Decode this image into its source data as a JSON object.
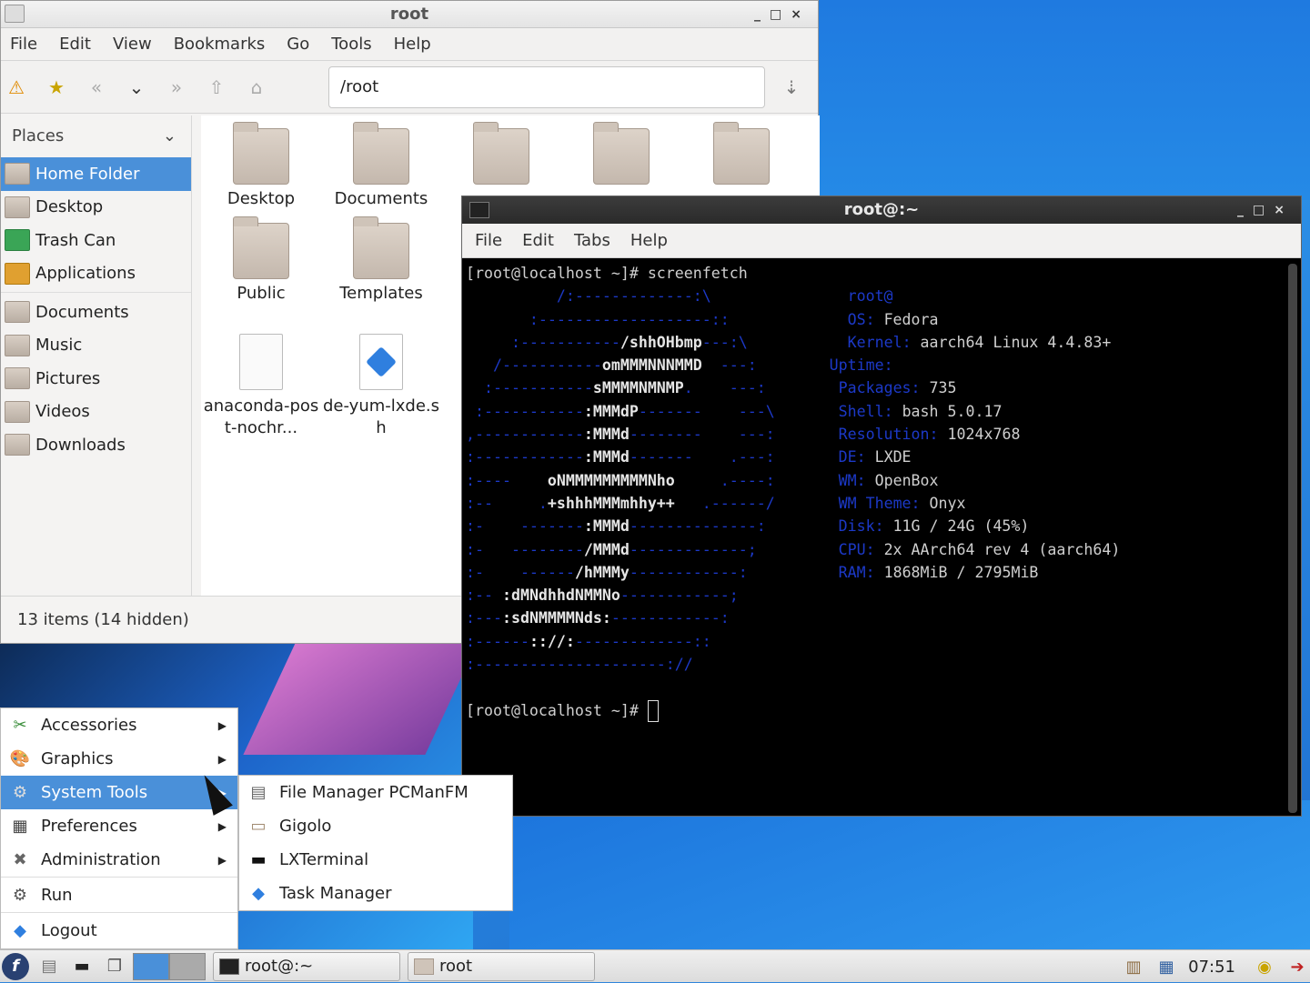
{
  "file_manager": {
    "title": "root",
    "window_controls": [
      "_",
      "□",
      "×"
    ],
    "menu": [
      "File",
      "Edit",
      "View",
      "Bookmarks",
      "Go",
      "Tools",
      "Help"
    ],
    "address": "/root",
    "places_label": "Places",
    "places": [
      {
        "label": "Home Folder",
        "icon": "home-folder-icon",
        "selected": true
      },
      {
        "label": "Desktop",
        "icon": "desktop-folder-icon"
      },
      {
        "label": "Trash Can",
        "icon": "trash-icon"
      },
      {
        "label": "Applications",
        "icon": "applications-icon"
      },
      {
        "label": "Documents",
        "icon": "documents-folder-icon"
      },
      {
        "label": "Music",
        "icon": "music-folder-icon"
      },
      {
        "label": "Pictures",
        "icon": "pictures-folder-icon"
      },
      {
        "label": "Videos",
        "icon": "videos-folder-icon"
      },
      {
        "label": "Downloads",
        "icon": "downloads-folder-icon"
      }
    ],
    "files": [
      {
        "name": "Desktop",
        "type": "folder"
      },
      {
        "name": "Documents",
        "type": "folder"
      },
      {
        "name": "Public",
        "type": "folder"
      },
      {
        "name": "Templates",
        "type": "folder"
      },
      {
        "name": "anaconda-post-nochr...",
        "type": "text"
      },
      {
        "name": "de-yum-lxde.sh",
        "type": "script"
      }
    ],
    "status": "13 items (14 hidden)"
  },
  "terminal": {
    "title": "root@:~",
    "menu": [
      "File",
      "Edit",
      "Tabs",
      "Help"
    ],
    "prompt": "[root@localhost ~]# ",
    "command": "screenfetch",
    "info": [
      {
        "key": "",
        "value": "root@"
      },
      {
        "key": "OS:",
        "value": " Fedora"
      },
      {
        "key": "Kernel:",
        "value": " aarch64 Linux 4.4.83+"
      },
      {
        "key": "Uptime:",
        "value": ""
      },
      {
        "key": "Packages:",
        "value": " 735"
      },
      {
        "key": "Shell:",
        "value": " bash 5.0.17"
      },
      {
        "key": "Resolution:",
        "value": " 1024x768"
      },
      {
        "key": "DE:",
        "value": " LXDE"
      },
      {
        "key": "WM:",
        "value": " OpenBox"
      },
      {
        "key": "WM Theme:",
        "value": " Onyx"
      },
      {
        "key": "Disk:",
        "value": " 11G / 24G (45%)"
      },
      {
        "key": "CPU:",
        "value": " 2x AArch64 rev 4 (aarch64)"
      },
      {
        "key": "RAM:",
        "value": " 1868MiB / 2795MiB"
      }
    ]
  },
  "start_menu": {
    "items": [
      {
        "label": "Accessories",
        "icon": "accessories-icon",
        "submenu": true
      },
      {
        "label": "Graphics",
        "icon": "graphics-icon",
        "submenu": true
      },
      {
        "label": "System Tools",
        "icon": "system-tools-icon",
        "submenu": true,
        "selected": true
      },
      {
        "label": "Preferences",
        "icon": "preferences-icon",
        "submenu": true
      },
      {
        "label": "Administration",
        "icon": "administration-icon",
        "submenu": true
      },
      {
        "label": "Run",
        "icon": "run-icon"
      },
      {
        "label": "Logout",
        "icon": "logout-icon"
      }
    ],
    "submenu": [
      {
        "label": "File Manager PCManFM",
        "icon": "file-manager-icon"
      },
      {
        "label": "Gigolo",
        "icon": "gigolo-icon"
      },
      {
        "label": "LXTerminal",
        "icon": "terminal-icon"
      },
      {
        "label": "Task Manager",
        "icon": "task-manager-icon"
      }
    ]
  },
  "taskbar": {
    "tasks": [
      "root@:~",
      "root"
    ],
    "clock": "07:51"
  },
  "colors": {
    "accent": "#4a90d9",
    "ascii_blue": "#1c39c8"
  }
}
